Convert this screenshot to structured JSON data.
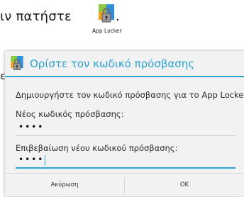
{
  "instruction": {
    "text": "ιν πατήστε",
    "period": ".",
    "app_icon": "app-locker-icon",
    "app_caption": "App Locker"
  },
  "background": {
    "stub_char": "ε"
  },
  "dialog": {
    "icon": "app-locker-icon",
    "title": "Ορίστε τον κωδικό πρόσβασης",
    "message": "Δημιουργήστε τον κωδικό πρόσβασης για το App Locker.",
    "new_password": {
      "label": "Νέος κωδικός πρόσβασης:",
      "value": "••••"
    },
    "confirm_password": {
      "label": "Επιβεβαίωση νέου κωδικού πρόσβασης:",
      "value": "••••"
    },
    "buttons": {
      "cancel": "Ακύρωση",
      "ok": "OK"
    }
  },
  "colors": {
    "accent": "#2aa3cf",
    "dialog_bg": "#f2f2f2"
  }
}
